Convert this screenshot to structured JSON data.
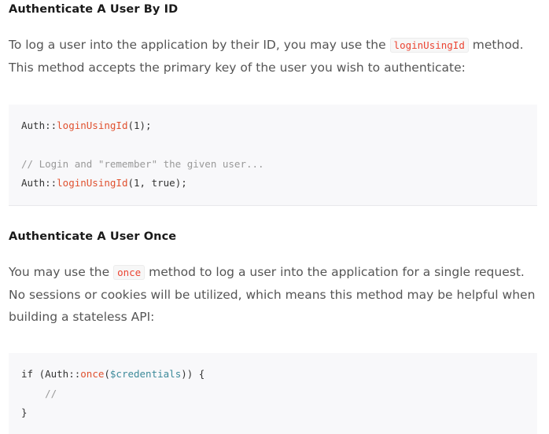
{
  "section1": {
    "heading": "Authenticate A User By ID",
    "para_line1_before": "To log a user into the application by their ID, you may use the ",
    "para_code": "loginUsingId",
    "para_line1_after": " method.",
    "para_line2": "This method accepts the primary key of the user you wish to authenticate:",
    "code": {
      "line1_class": "Auth::",
      "line1_method": "loginUsingId",
      "line1_args": "(1);",
      "comment": "// Login and \"remember\" the given user...",
      "line3_class": "Auth::",
      "line3_method": "loginUsingId",
      "line3_args_open": "(1, ",
      "line3_bool": "true",
      "line3_args_close": ");"
    }
  },
  "section2": {
    "heading": "Authenticate A User Once",
    "para_before": "You may use the ",
    "para_code": "once",
    "para_after": " method to log a user into the application for a single request. No sessions or cookies will be utilized, which means this method may be helpful when building a stateless API:",
    "code": {
      "line1_kw": "if (",
      "line1_class": "Auth::",
      "line1_method": "once",
      "line1_open": "(",
      "line1_var": "$credentials",
      "line1_close": ")) {",
      "line2_comment": "    //",
      "line3": "}"
    }
  }
}
